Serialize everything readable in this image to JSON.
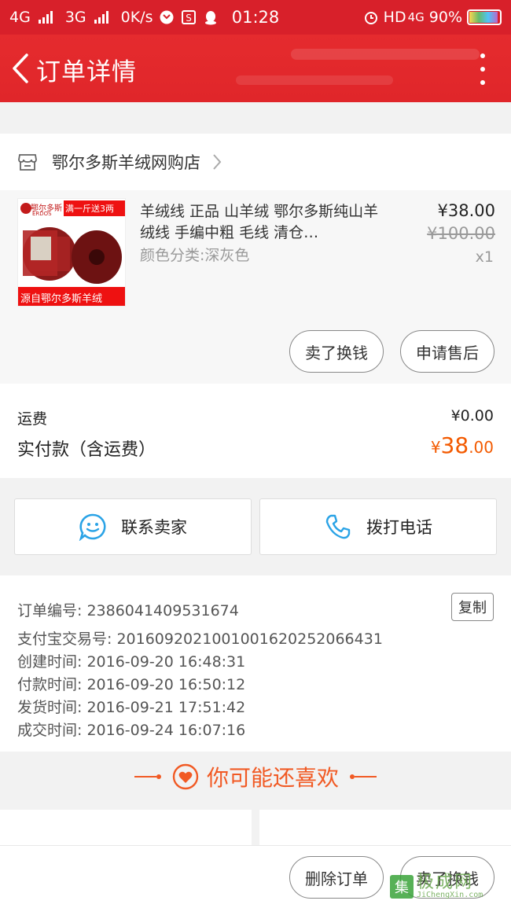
{
  "status_bar": {
    "net1": "4G",
    "net2": "3G",
    "speed": "0K/s",
    "time": "01:28",
    "hd_label": "HD",
    "net3": "4G",
    "battery": "90%",
    "battery_level": 0.9
  },
  "header": {
    "title": "订单详情"
  },
  "shop": {
    "name": "鄂尔多斯羊绒网购店"
  },
  "product": {
    "image_brand": "鄂尔多斯",
    "image_brand_en": "ERDOS",
    "image_promo": "满一斤送3两",
    "image_caption": "源自鄂尔多斯羊绒",
    "title": "羊绒线 正品 山羊绒 鄂尔多斯纯山羊绒线 手编中粗 毛线 清仓…",
    "sku": "颜色分类:深灰色",
    "price": "¥38.00",
    "original_price": "¥100.00",
    "quantity": "x1",
    "sell_button": "卖了换钱",
    "aftersale_button": "申请售后"
  },
  "payment": {
    "freight_label": "运费",
    "freight_value": "¥0.00",
    "total_label": "实付款（含运费）",
    "total_yen": "¥",
    "total_int": "38",
    "total_dec": ".00"
  },
  "contact": {
    "seller_label": "联系卖家",
    "phone_label": "拨打电话"
  },
  "order_info": {
    "order_no": "订单编号: 2386041409531674",
    "alipay_no": "支付宝交易号: 2016092021001001620252066431",
    "created": "创建时间: 2016-09-20 16:48:31",
    "paid": "付款时间: 2016-09-20 16:50:12",
    "shipped": "发货时间: 2016-09-21 17:51:42",
    "completed": "成交时间: 2016-09-24 16:07:16",
    "copy_label": "复制"
  },
  "recommend": {
    "title": "你可能还喜欢"
  },
  "bottom_bar": {
    "delete_button": "删除订单",
    "sell_button": "卖了换钱"
  },
  "watermark": {
    "cn": "极成网",
    "en": "JiChengXin.com",
    "badge": "集"
  },
  "colors": {
    "header_red": "#e0262a",
    "accent_orange": "#f35a00",
    "contact_blue": "#2aa3e6"
  }
}
